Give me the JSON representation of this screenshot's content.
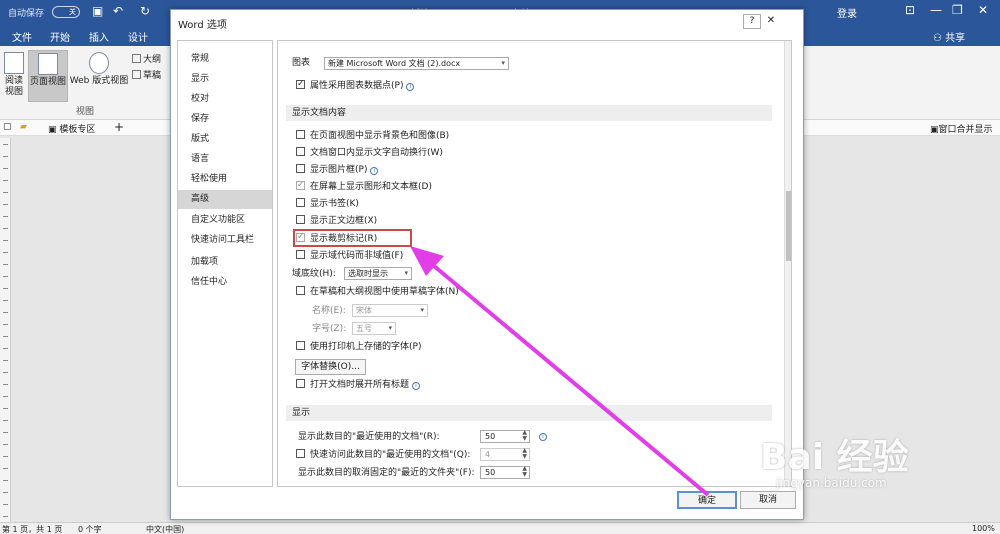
{
  "titlebar": {
    "autosave": "自动保存",
    "autosave_state": "关",
    "doc_title": "新建 Microsoft Word 文档 (2).docx  -  Word",
    "login": "登录"
  },
  "menu": [
    "文件",
    "开始",
    "插入",
    "设计"
  ],
  "share": "共享",
  "ribbon": {
    "read_mode": "阅读\n视图",
    "print_layout": "页面视图",
    "web_layout": "Web 版式视图",
    "outline": "大纲",
    "draft": "草稿",
    "group_label": "视图"
  },
  "tabrow": {
    "template_zone": "模板专区",
    "merge": "窗口合并显示"
  },
  "status": {
    "page": "第 1 页，共 1 页",
    "words": "0 个字",
    "lang": "中文(中国)",
    "zoom": "100%"
  },
  "dialog": {
    "title": "Word 选项",
    "help": "?",
    "close": "✕",
    "nav": [
      "常规",
      "显示",
      "校对",
      "保存",
      "版式",
      "语言",
      "轻松使用",
      "高级",
      "自定义功能区",
      "快速访问工具栏",
      "加载项",
      "信任中心"
    ],
    "nav_selected": 7,
    "chart_label": "图表",
    "chart_doc": "新建 Microsoft Word 文档 (2).docx",
    "chart_prop": "属性采用图表数据点(P)",
    "sec_show_doc": "显示文档内容",
    "opts": [
      {
        "label": "在页面视图中显示背景色和图像(B)",
        "checked": false
      },
      {
        "label": "文档窗口内显示文字自动换行(W)",
        "checked": false
      },
      {
        "label": "显示图片框(P)",
        "checked": false
      },
      {
        "label": "在屏幕上显示图形和文本框(D)",
        "checked": true
      },
      {
        "label": "显示书签(K)",
        "checked": false
      },
      {
        "label": "显示正文边框(X)",
        "checked": false
      },
      {
        "label": "显示裁剪标记(R)",
        "checked": true
      },
      {
        "label": "显示域代码而非域值(F)",
        "checked": false
      }
    ],
    "shading_label": "域底纹(H):",
    "shading_value": "选取时显示",
    "draft_font": "在草稿和大纲视图中使用草稿字体(N)",
    "name_label": "名称(E):",
    "name_value": "宋体",
    "size_label": "字号(Z):",
    "size_value": "五号",
    "printer_fonts": "使用打印机上存储的字体(P)",
    "font_sub": "字体替换(O)...",
    "expand_headings": "打开文档时展开所有标题",
    "sec_display": "显示",
    "recent_docs": "显示此数目的\"最近使用的文档\"(R):",
    "recent_docs_val": "50",
    "quick_access": "快速访问此数目的\"最近使用的文档\"(Q):",
    "quick_access_val": "4",
    "unpinned_folders": "显示此数目的取消固定的\"最近的文件夹\"(F):",
    "unpinned_folders_val": "50",
    "ok": "确定",
    "cancel": "取消"
  },
  "watermark": {
    "logo": "Bai 经验",
    "url": "jingyan.baidu.com"
  }
}
